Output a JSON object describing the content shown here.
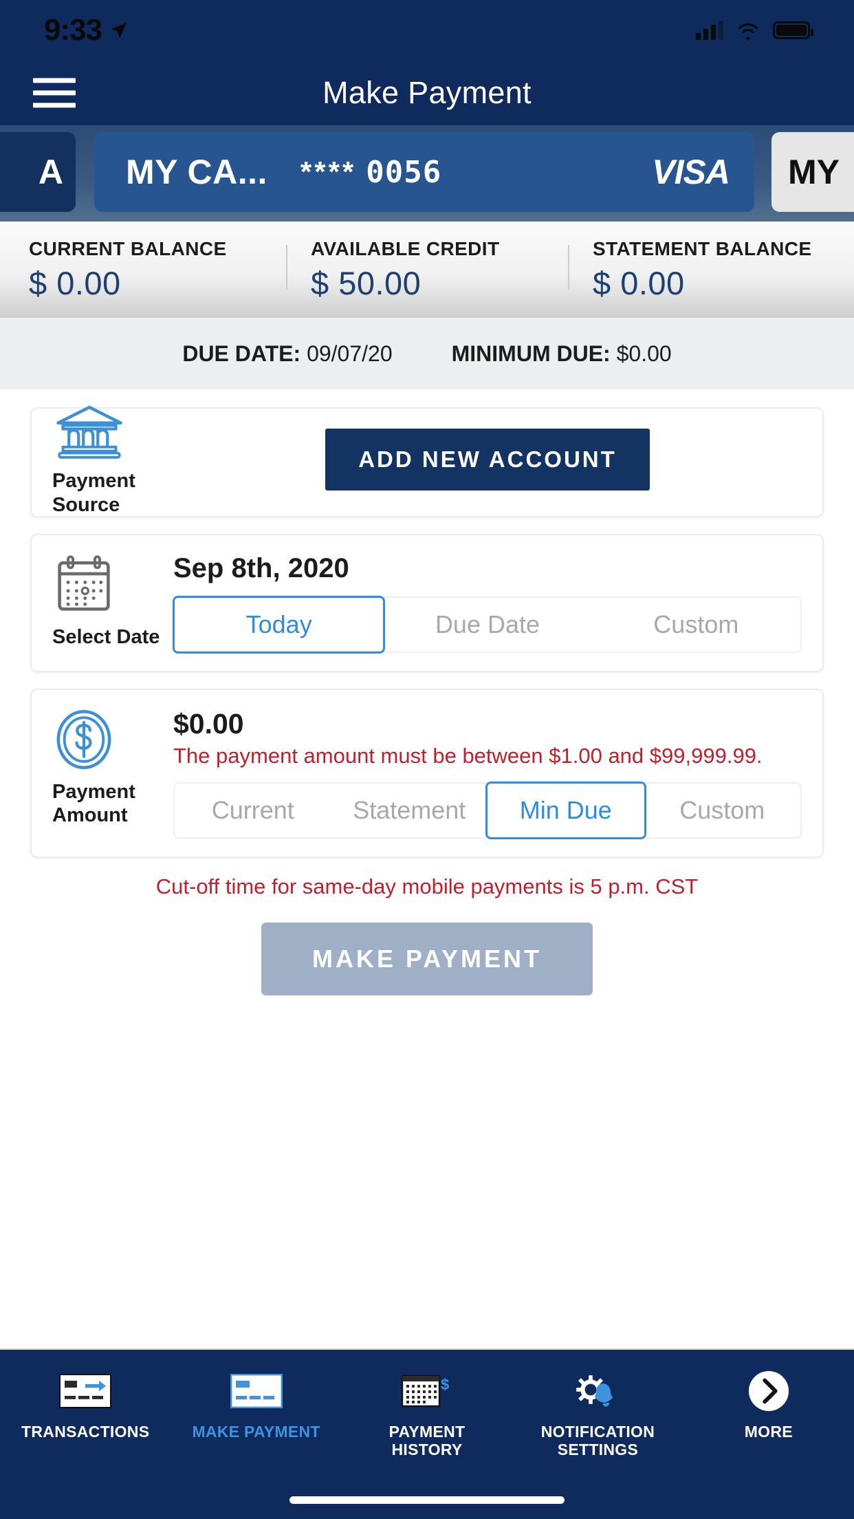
{
  "status_bar": {
    "time": "9:33",
    "location_icon": "location-arrow-icon",
    "signal_icon": "cellular-signal-icon",
    "wifi_icon": "wifi-icon",
    "battery_icon": "battery-full-icon"
  },
  "nav": {
    "menu_icon": "hamburger-menu-icon",
    "title": "Make Payment"
  },
  "cards": {
    "previous": {
      "name": "A"
    },
    "active": {
      "name": "MY CA...",
      "mask": "****",
      "last4": "0056",
      "network": "VISA"
    },
    "next": {
      "name": "MY"
    }
  },
  "balances": [
    {
      "label": "CURRENT BALANCE",
      "value": "$ 0.00"
    },
    {
      "label": "AVAILABLE CREDIT",
      "value": "$ 50.00"
    },
    {
      "label": "STATEMENT BALANCE",
      "value": "$ 0.00"
    }
  ],
  "due_bar": {
    "due_date_label": "DUE DATE:",
    "due_date_value": "09/07/20",
    "minimum_due_label": "MINIMUM DUE:",
    "minimum_due_value": "$0.00"
  },
  "payment_source": {
    "icon": "bank-building-icon",
    "label": "Payment\nSource",
    "label_line1": "Payment",
    "label_line2": "Source",
    "add_button": "ADD NEW ACCOUNT"
  },
  "select_date": {
    "icon": "calendar-icon",
    "label": "Select Date",
    "date_value": "Sep 8th, 2020",
    "options": [
      {
        "label": "Today",
        "selected": true
      },
      {
        "label": "Due Date",
        "selected": false
      },
      {
        "label": "Custom",
        "selected": false
      }
    ]
  },
  "payment_amount": {
    "icon": "dollar-coin-icon",
    "label_line1": "Payment",
    "label_line2": "Amount",
    "amount_value": "$0.00",
    "error_message": "The payment amount must be between $1.00 and $99,999.99.",
    "options": [
      {
        "label": "Current",
        "selected": false
      },
      {
        "label": "Statement",
        "selected": false
      },
      {
        "label": "Min Due",
        "selected": true
      },
      {
        "label": "Custom",
        "selected": false
      }
    ]
  },
  "cutoff_notice": "Cut-off time for same-day mobile payments is 5 p.m. CST",
  "submit_button": "MAKE PAYMENT",
  "tabs": [
    {
      "label": "TRANSACTIONS",
      "icon": "card-arrow-icon",
      "active": false
    },
    {
      "label": "MAKE PAYMENT",
      "icon": "card-payment-icon",
      "active": true
    },
    {
      "label": "PAYMENT HISTORY",
      "line1": "PAYMENT",
      "line2": "HISTORY",
      "icon": "calendar-dollar-icon",
      "active": false
    },
    {
      "label": "NOTIFICATION SETTINGS",
      "line1": "NOTIFICATION",
      "line2": "SETTINGS",
      "icon": "gear-bell-icon",
      "active": false
    },
    {
      "label": "MORE",
      "icon": "chevron-right-circle-icon",
      "active": false
    }
  ],
  "colors": {
    "navy": "#0f2a5c",
    "card_blue": "#27558f",
    "accent_blue": "#2f8ce0",
    "error_red": "#c0202c",
    "disabled_button": "#9fb0c6",
    "button_navy": "#133463"
  }
}
